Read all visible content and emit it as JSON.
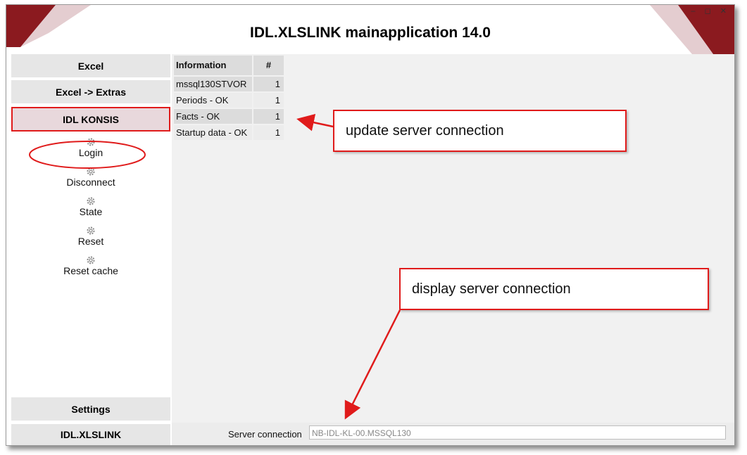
{
  "window": {
    "title": "IDL.XLSLINK mainapplication 14.0",
    "controls": "– ◻ ✕"
  },
  "sidebar": {
    "tabs": [
      {
        "label": "Excel"
      },
      {
        "label": "Excel -> Extras"
      },
      {
        "label": "IDL KONSIS"
      }
    ],
    "commands": [
      {
        "label": "Login",
        "icon": "gear-icon"
      },
      {
        "label": "Disconnect",
        "icon": "gear-icon"
      },
      {
        "label": "State",
        "icon": "gear-icon"
      },
      {
        "label": "Reset",
        "icon": "gear-icon"
      },
      {
        "label": "Reset cache",
        "icon": "gear-icon"
      }
    ],
    "bottom_tabs": [
      {
        "label": "Settings"
      },
      {
        "label": "IDL.XLSLINK"
      }
    ]
  },
  "info_table": {
    "headers": [
      "Information",
      "#"
    ],
    "rows": [
      [
        "mssql130STVOR",
        "1"
      ],
      [
        "Periods - OK",
        "1"
      ],
      [
        "Facts - OK",
        "1"
      ],
      [
        "Startup data - OK",
        "1"
      ]
    ]
  },
  "status_bar": {
    "label": "Server connection",
    "value": "NB-IDL-KL-00.MSSQL130"
  },
  "annotations": {
    "update_callout": "update server connection",
    "display_callout": "display server connection"
  },
  "colors": {
    "accent": "#e01b1b",
    "active_tab_bg": "#e8d8dc",
    "decoration": "#8b1a1f"
  }
}
